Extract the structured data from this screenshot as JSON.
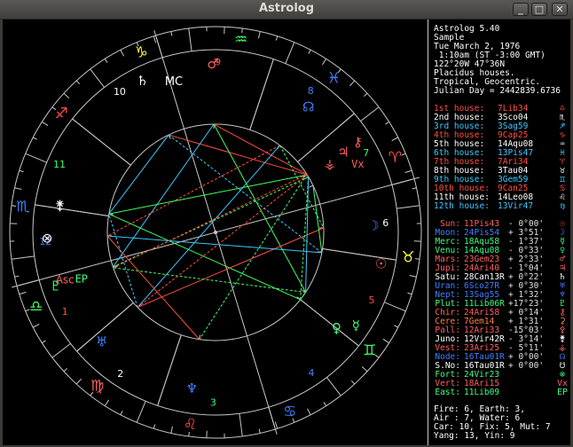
{
  "window": {
    "title": "Astrolog",
    "buttons": [
      {
        "label": "_",
        "name": "minimize-button"
      },
      {
        "label": "□",
        "name": "maximize-button"
      },
      {
        "label": "✕",
        "name": "close-button"
      }
    ]
  },
  "info": {
    "lines": [
      "Astrolog 5.40",
      "Sample",
      "Tue March 2, 1976",
      " 1:10am (ST -3:00 GMT)",
      "122°20W 47°36N",
      "Placidus houses.",
      "Tropical, Geocentric.",
      "Julian Day = 2442839.6736"
    ]
  },
  "houses": [
    {
      "label": "1st house:",
      "value": "7Lib34",
      "color": "#ff5040",
      "sym": "♎"
    },
    {
      "label": "2nd house:",
      "value": "3Sco04",
      "color": "#ffffff",
      "sym": "♏"
    },
    {
      "label": "3rd house:",
      "value": "3Sag59",
      "color": "#40c8ff",
      "sym": "♐"
    },
    {
      "label": "4th house:",
      "value": "9Cap25",
      "color": "#ff5040",
      "sym": "♑"
    },
    {
      "label": "5th house:",
      "value": "14Aqu08",
      "color": "#ffffff",
      "sym": "♒"
    },
    {
      "label": "6th house:",
      "value": "13Pis47",
      "color": "#40c8ff",
      "sym": "♓"
    },
    {
      "label": "7th house:",
      "value": "7Ari34",
      "color": "#ff5040",
      "sym": "♈"
    },
    {
      "label": "8th house:",
      "value": "3Tau04",
      "color": "#ffffff",
      "sym": "♉"
    },
    {
      "label": "9th house:",
      "value": "3Gem59",
      "color": "#40c8ff",
      "sym": "♊"
    },
    {
      "label": "10th house:",
      "value": "9Can25",
      "color": "#ff5040",
      "sym": "♋"
    },
    {
      "label": "11th house:",
      "value": "14Leo08",
      "color": "#ffffff",
      "sym": "♌"
    },
    {
      "label": "12th house:",
      "value": "13Vir47",
      "color": "#40c8ff",
      "sym": "♍"
    }
  ],
  "planets": [
    {
      "label": "Sun:",
      "value": "11Pis43",
      "detail": "- 0°00'",
      "color": "#ff6060",
      "sym": "☉"
    },
    {
      "label": "Moon:",
      "value": "24Pis54",
      "detail": "+ 3°51'",
      "color": "#4080ff",
      "sym": "☽"
    },
    {
      "label": "Merc:",
      "value": "18Aqu58",
      "detail": "- 1°37'",
      "color": "#40ff80",
      "sym": "☿"
    },
    {
      "label": "Venu:",
      "value": "14Aqu08",
      "detail": "- 0°33'",
      "color": "#40ff80",
      "sym": "♀"
    },
    {
      "label": "Mars:",
      "value": "23Gem23",
      "detail": "+ 2°33'",
      "color": "#ff6060",
      "sym": "♂"
    },
    {
      "label": "Jupi:",
      "value": "24Ari40",
      "detail": "- 1°04'",
      "color": "#ff6060",
      "sym": "♃"
    },
    {
      "label": "Satu:",
      "value": "28Can13R",
      "detail": "+ 0°22'",
      "color": "#ffffff",
      "sym": "♄"
    },
    {
      "label": "Uran:",
      "value": "6Sco27R",
      "detail": "+ 0°30'",
      "color": "#4080ff",
      "sym": "♅"
    },
    {
      "label": "Nept:",
      "value": "13Sag55",
      "detail": "+ 1°32'",
      "color": "#4080ff",
      "sym": "♆"
    },
    {
      "label": "Plut:",
      "value": "11Lib06R",
      "detail": "+17°23'",
      "color": "#40ff80",
      "sym": "♇"
    },
    {
      "label": "Chir:",
      "value": "24Ari58",
      "detail": "+ 0°14'",
      "color": "#ff6060",
      "sym": "⚷"
    },
    {
      "label": "Cere:",
      "value": "7Gem14",
      "detail": "+ 1°31'",
      "color": "#ff8040",
      "sym": "⚳"
    },
    {
      "label": "Pall:",
      "value": "12Ari33",
      "detail": "-15°03'",
      "color": "#ff6060",
      "sym": "⚴"
    },
    {
      "label": "Juno:",
      "value": "12Vir42R",
      "detail": "- 3°14'",
      "color": "#ffffff",
      "sym": "⚵"
    },
    {
      "label": "Vest:",
      "value": "23Ari25",
      "detail": "- 5°11'",
      "color": "#ff6060",
      "sym": "⚶"
    },
    {
      "label": "Node:",
      "value": "16Tau01R",
      "detail": "+ 0°00'",
      "color": "#4080ff",
      "sym": "☊"
    },
    {
      "label": "S.No:",
      "value": "16Tau01R",
      "detail": "+ 0°00'",
      "color": "#ffffff",
      "sym": "☋"
    },
    {
      "label": "Fort:",
      "value": "24Vir23",
      "detail": "",
      "color": "#40ff80",
      "sym": "⊗"
    },
    {
      "label": "Vert:",
      "value": "18Ari15",
      "detail": "",
      "color": "#ff6060",
      "sym": "Vx"
    },
    {
      "label": "East:",
      "value": "11Lib09",
      "detail": "",
      "color": "#40ff80",
      "sym": "EP"
    }
  ],
  "summary": [
    "Fire: 6, Earth: 3,",
    "Air : 7, Water: 6",
    "Car: 10, Fix: 5, Mut: 7",
    "Yang: 13, Yin: 9"
  ],
  "wheel": {
    "house_numbers": [
      "1",
      "2",
      "3",
      "4",
      "5",
      "6",
      "7",
      "8",
      "9",
      "10",
      "11",
      "12"
    ],
    "house_number_colors": [
      "#ff5040",
      "#ffffff",
      "#40ff60",
      "#4080ff",
      "#ff5040",
      "#ffffff",
      "#40ff60",
      "#4080ff",
      "#ff5040",
      "#ffffff",
      "#40ff60",
      "#4080ff"
    ],
    "sign_glyphs": [
      {
        "glyph": "♎",
        "color": "#40ff60",
        "name": "libra-icon"
      },
      {
        "glyph": "♍",
        "color": "#ff6060",
        "name": "virgo-icon"
      },
      {
        "glyph": "♌",
        "color": "#ff5040",
        "name": "leo-icon"
      },
      {
        "glyph": "♋",
        "color": "#4080ff",
        "name": "cancer-icon"
      },
      {
        "glyph": "♊",
        "color": "#40ff60",
        "name": "gemini-icon"
      },
      {
        "glyph": "♉",
        "color": "#ffff40",
        "name": "taurus-icon"
      },
      {
        "glyph": "♈",
        "color": "#ff5040",
        "name": "aries-icon"
      },
      {
        "glyph": "♓",
        "color": "#4080ff",
        "name": "pisces-icon"
      },
      {
        "glyph": "♒",
        "color": "#40ff60",
        "name": "aquarius-icon"
      },
      {
        "glyph": "♑",
        "color": "#ffff40",
        "name": "capricorn-icon"
      },
      {
        "glyph": "♐",
        "color": "#ff5040",
        "name": "sagittarius-icon"
      },
      {
        "glyph": "♏",
        "color": "#4080ff",
        "name": "scorpio-icon"
      }
    ],
    "asc_label": "Asc",
    "mc_label": "MC",
    "planet_glyphs": [
      {
        "glyph": "♄",
        "color": "#ffffff",
        "name": "saturn-icon"
      },
      {
        "glyph": "♂",
        "color": "#ff6060",
        "name": "mars-icon"
      },
      {
        "glyph": "♀",
        "color": "#40ff80",
        "name": "venus-icon"
      },
      {
        "glyph": "☊",
        "color": "#4080ff",
        "name": "node-icon"
      },
      {
        "glyph": "⚷",
        "color": "#ff6060",
        "name": "chiron-icon"
      },
      {
        "glyph": "♃",
        "color": "#ff6060",
        "name": "jupiter-icon"
      },
      {
        "glyph": "⚶",
        "color": "#ff6060",
        "name": "vesta-icon"
      },
      {
        "glyph": "☽",
        "color": "#4080ff",
        "name": "moon-icon"
      },
      {
        "glyph": "☉",
        "color": "#ff6060",
        "name": "sun-icon"
      },
      {
        "glyph": "☿",
        "color": "#40ff80",
        "name": "mercury-icon"
      },
      {
        "glyph": "♆",
        "color": "#4080ff",
        "name": "neptune-icon"
      },
      {
        "glyph": "♅",
        "color": "#4080ff",
        "name": "uranus-icon"
      },
      {
        "glyph": "♇",
        "color": "#40ff80",
        "name": "pluto-icon"
      },
      {
        "glyph": "⚵",
        "color": "#ffffff",
        "name": "juno-icon"
      },
      {
        "glyph": "⊗",
        "color": "#ffffff",
        "name": "fortune-icon"
      },
      {
        "glyph": "EP",
        "color": "#40ff80",
        "name": "east-point-icon"
      },
      {
        "glyph": "Vx",
        "color": "#ff6060",
        "name": "vertex-icon"
      }
    ]
  }
}
